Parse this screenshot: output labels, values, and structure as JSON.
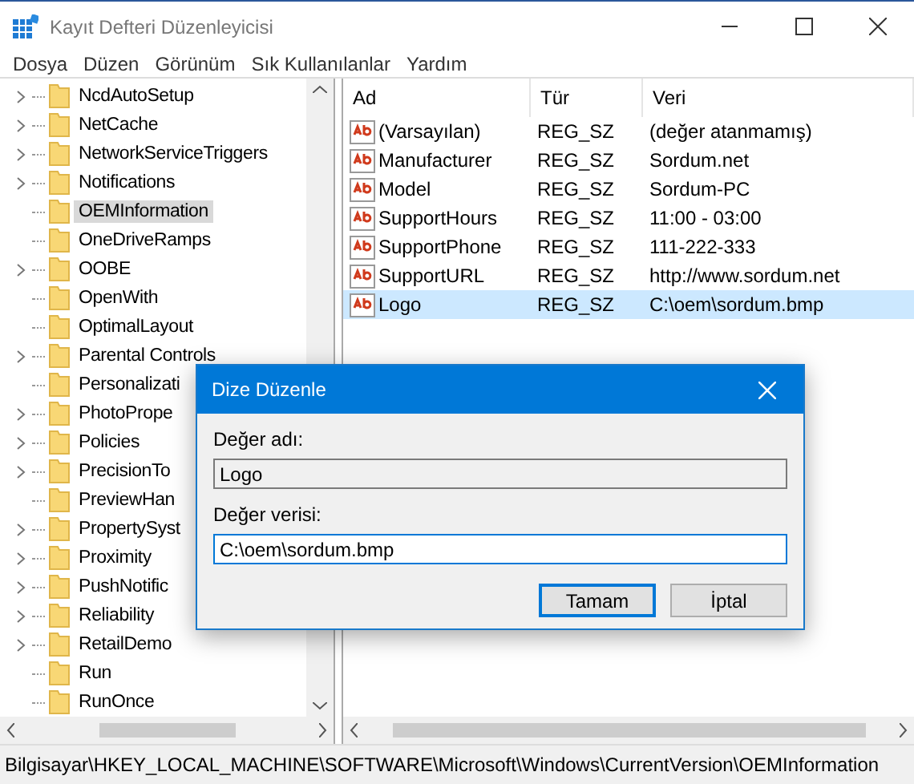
{
  "window": {
    "title": "Kayıt Defteri Düzenleyicisi"
  },
  "menu": [
    "Dosya",
    "Düzen",
    "Görünüm",
    "Sık Kullanılanlar",
    "Yardım"
  ],
  "tree": [
    {
      "label": "NcdAutoSetup",
      "expandable": true,
      "selected": false
    },
    {
      "label": "NetCache",
      "expandable": true,
      "selected": false
    },
    {
      "label": "NetworkServiceTriggers",
      "expandable": true,
      "selected": false
    },
    {
      "label": "Notifications",
      "expandable": true,
      "selected": false
    },
    {
      "label": "OEMInformation",
      "expandable": false,
      "selected": true
    },
    {
      "label": "OneDriveRamps",
      "expandable": false,
      "selected": false
    },
    {
      "label": "OOBE",
      "expandable": true,
      "selected": false
    },
    {
      "label": "OpenWith",
      "expandable": false,
      "selected": false
    },
    {
      "label": "OptimalLayout",
      "expandable": false,
      "selected": false
    },
    {
      "label": "Parental Controls",
      "expandable": true,
      "selected": false
    },
    {
      "label": "Personalizati",
      "expandable": false,
      "selected": false
    },
    {
      "label": "PhotoPrope",
      "expandable": true,
      "selected": false
    },
    {
      "label": "Policies",
      "expandable": true,
      "selected": false
    },
    {
      "label": "PrecisionTo",
      "expandable": true,
      "selected": false
    },
    {
      "label": "PreviewHan",
      "expandable": false,
      "selected": false
    },
    {
      "label": "PropertySyst",
      "expandable": true,
      "selected": false
    },
    {
      "label": "Proximity",
      "expandable": true,
      "selected": false
    },
    {
      "label": "PushNotific",
      "expandable": true,
      "selected": false
    },
    {
      "label": "Reliability",
      "expandable": true,
      "selected": false
    },
    {
      "label": "RetailDemo",
      "expandable": true,
      "selected": false
    },
    {
      "label": "Run",
      "expandable": false,
      "selected": false
    },
    {
      "label": "RunOnce",
      "expandable": false,
      "selected": false
    }
  ],
  "values": {
    "columns": [
      "Ad",
      "Tür",
      "Veri"
    ],
    "rows": [
      {
        "name": "(Varsayılan)",
        "type": "REG_SZ",
        "data": "(değer atanmamış)",
        "selected": false
      },
      {
        "name": "Manufacturer",
        "type": "REG_SZ",
        "data": "Sordum.net",
        "selected": false
      },
      {
        "name": "Model",
        "type": "REG_SZ",
        "data": "Sordum-PC",
        "selected": false
      },
      {
        "name": "SupportHours",
        "type": "REG_SZ",
        "data": "11:00 - 03:00",
        "selected": false
      },
      {
        "name": "SupportPhone",
        "type": "REG_SZ",
        "data": "111-222-333",
        "selected": false
      },
      {
        "name": "SupportURL",
        "type": "REG_SZ",
        "data": "http://www.sordum.net",
        "selected": false
      },
      {
        "name": "Logo",
        "type": "REG_SZ",
        "data": "C:\\oem\\sordum.bmp",
        "selected": true
      }
    ]
  },
  "dialog": {
    "title": "Dize Düzenle",
    "name_label": "Değer adı:",
    "name_value": "Logo",
    "data_label": "Değer verisi:",
    "data_value": "C:\\oem\\sordum.bmp",
    "buttons": [
      "Tamam",
      "İptal"
    ]
  },
  "status_bar": "Bilgisayar\\HKEY_LOCAL_MACHINE\\SOFTWARE\\Microsoft\\Windows\\CurrentVersion\\OEMInformation"
}
